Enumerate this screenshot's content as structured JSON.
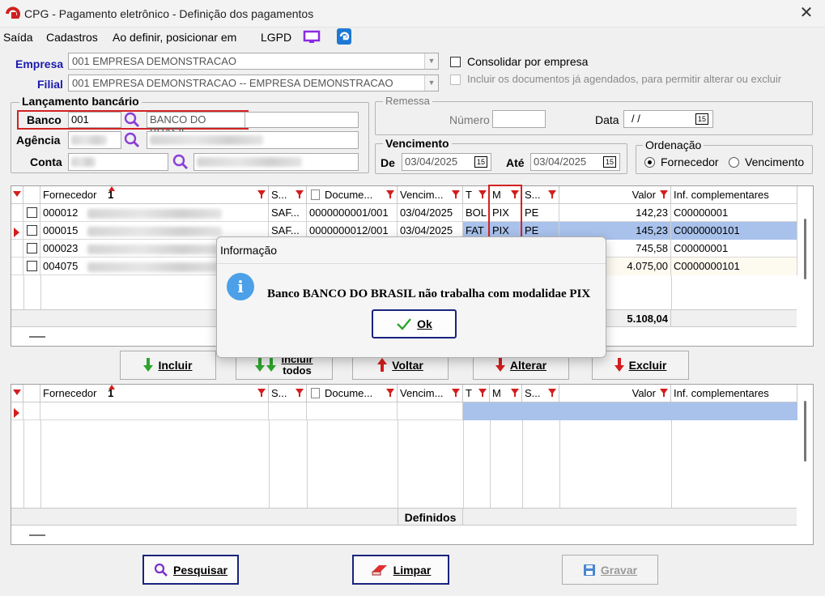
{
  "window": {
    "title": "CPG - Pagamento eletrônico - Definição dos pagamentos",
    "close_glyph": "✕"
  },
  "menu": {
    "items": [
      "Saída",
      "Cadastros",
      "Ao definir, posicionar em",
      "LGPD"
    ]
  },
  "filters": {
    "empresa_label": "Empresa",
    "empresa_value": "001 EMPRESA DEMONSTRACAO",
    "filial_label": "Filial",
    "filial_value": "001 EMPRESA DEMONSTRACAO -- EMPRESA DEMONSTRACAO",
    "consolidar_label": "Consolidar por empresa",
    "incluir_docs_label": "Incluir os documentos já agendados, para permitir alterar ou excluir"
  },
  "lancamento": {
    "title": "Lançamento bancário",
    "banco_label": "Banco",
    "banco_code": "001",
    "banco_name": "BANCO DO BRASIL",
    "agencia_label": "Agência",
    "conta_label": "Conta"
  },
  "remessa": {
    "title": "Remessa",
    "numero_label": "Número",
    "numero_value": "",
    "data_label": "Data",
    "data_value": "/ /"
  },
  "vencimento": {
    "title": "Vencimento",
    "de_label": "De",
    "de_value": "03/04/2025",
    "ate_label": "Até",
    "ate_value": "03/04/2025"
  },
  "ordenacao": {
    "title": "Ordenação",
    "opt1": "Fornecedor",
    "opt2": "Vencimento",
    "selected": "Fornecedor"
  },
  "grid_top": {
    "headers": {
      "fornecedor": "Fornecedor",
      "sort": "1",
      "s1": "S...",
      "documento": "Docume...",
      "vencimento": "Vencim...",
      "t": "T",
      "m": "M",
      "s2": "S...",
      "valor": "Valor",
      "inf": "Inf. complementares"
    },
    "rows": [
      {
        "fornecedor": "000012",
        "s": "SAF...",
        "documento": "0000000001/001",
        "vencimento": "03/04/2025",
        "t": "BOL",
        "m": "PIX",
        "s2": "PE",
        "valor": "142,23",
        "inf": "C00000001"
      },
      {
        "fornecedor": "000015",
        "s": "SAF...",
        "documento": "0000000012/001",
        "vencimento": "03/04/2025",
        "t": "FAT",
        "m": "PIX",
        "s2": "PE",
        "valor": "145,23",
        "inf": "C0000000101"
      },
      {
        "fornecedor": "000023",
        "s": "",
        "documento": "",
        "vencimento": "",
        "t": "",
        "m": "",
        "s2": "",
        "valor": "745,58",
        "inf": "C00000001"
      },
      {
        "fornecedor": "004075",
        "s": "",
        "documento": "",
        "vencimento": "",
        "t": "",
        "m": "",
        "s2": "",
        "valor": "4.075,00",
        "inf": "C0000000101"
      }
    ],
    "total": "5.108,04"
  },
  "action_buttons": {
    "incluir": "Incluir",
    "incluir_todos_1": "Incluir",
    "incluir_todos_2": "todos",
    "voltar": "Voltar",
    "alterar": "Alterar",
    "excluir": "Excluir"
  },
  "grid_bottom": {
    "headers": {
      "fornecedor": "Fornecedor",
      "sort": "1",
      "s1": "S...",
      "documento": "Docume...",
      "vencimento": "Vencim...",
      "t": "T",
      "m": "M",
      "s2": "S...",
      "valor": "Valor",
      "inf": "Inf. complementares"
    },
    "footer_label": "Definidos"
  },
  "bottom_buttons": {
    "pesquisar": "Pesquisar",
    "limpar": "Limpar",
    "gravar": "Gravar"
  },
  "dialog": {
    "title": "Informação",
    "message": "Banco BANCO DO BRASIL não trabalha com modalidae PIX",
    "ok": "Ok",
    "icon_glyph": "i"
  },
  "colors": {
    "accent_blue": "#1a1ab0",
    "highlight_red": "#d32222",
    "selected_row": "#a9c2ec",
    "info_blue": "#4ba0e8"
  }
}
